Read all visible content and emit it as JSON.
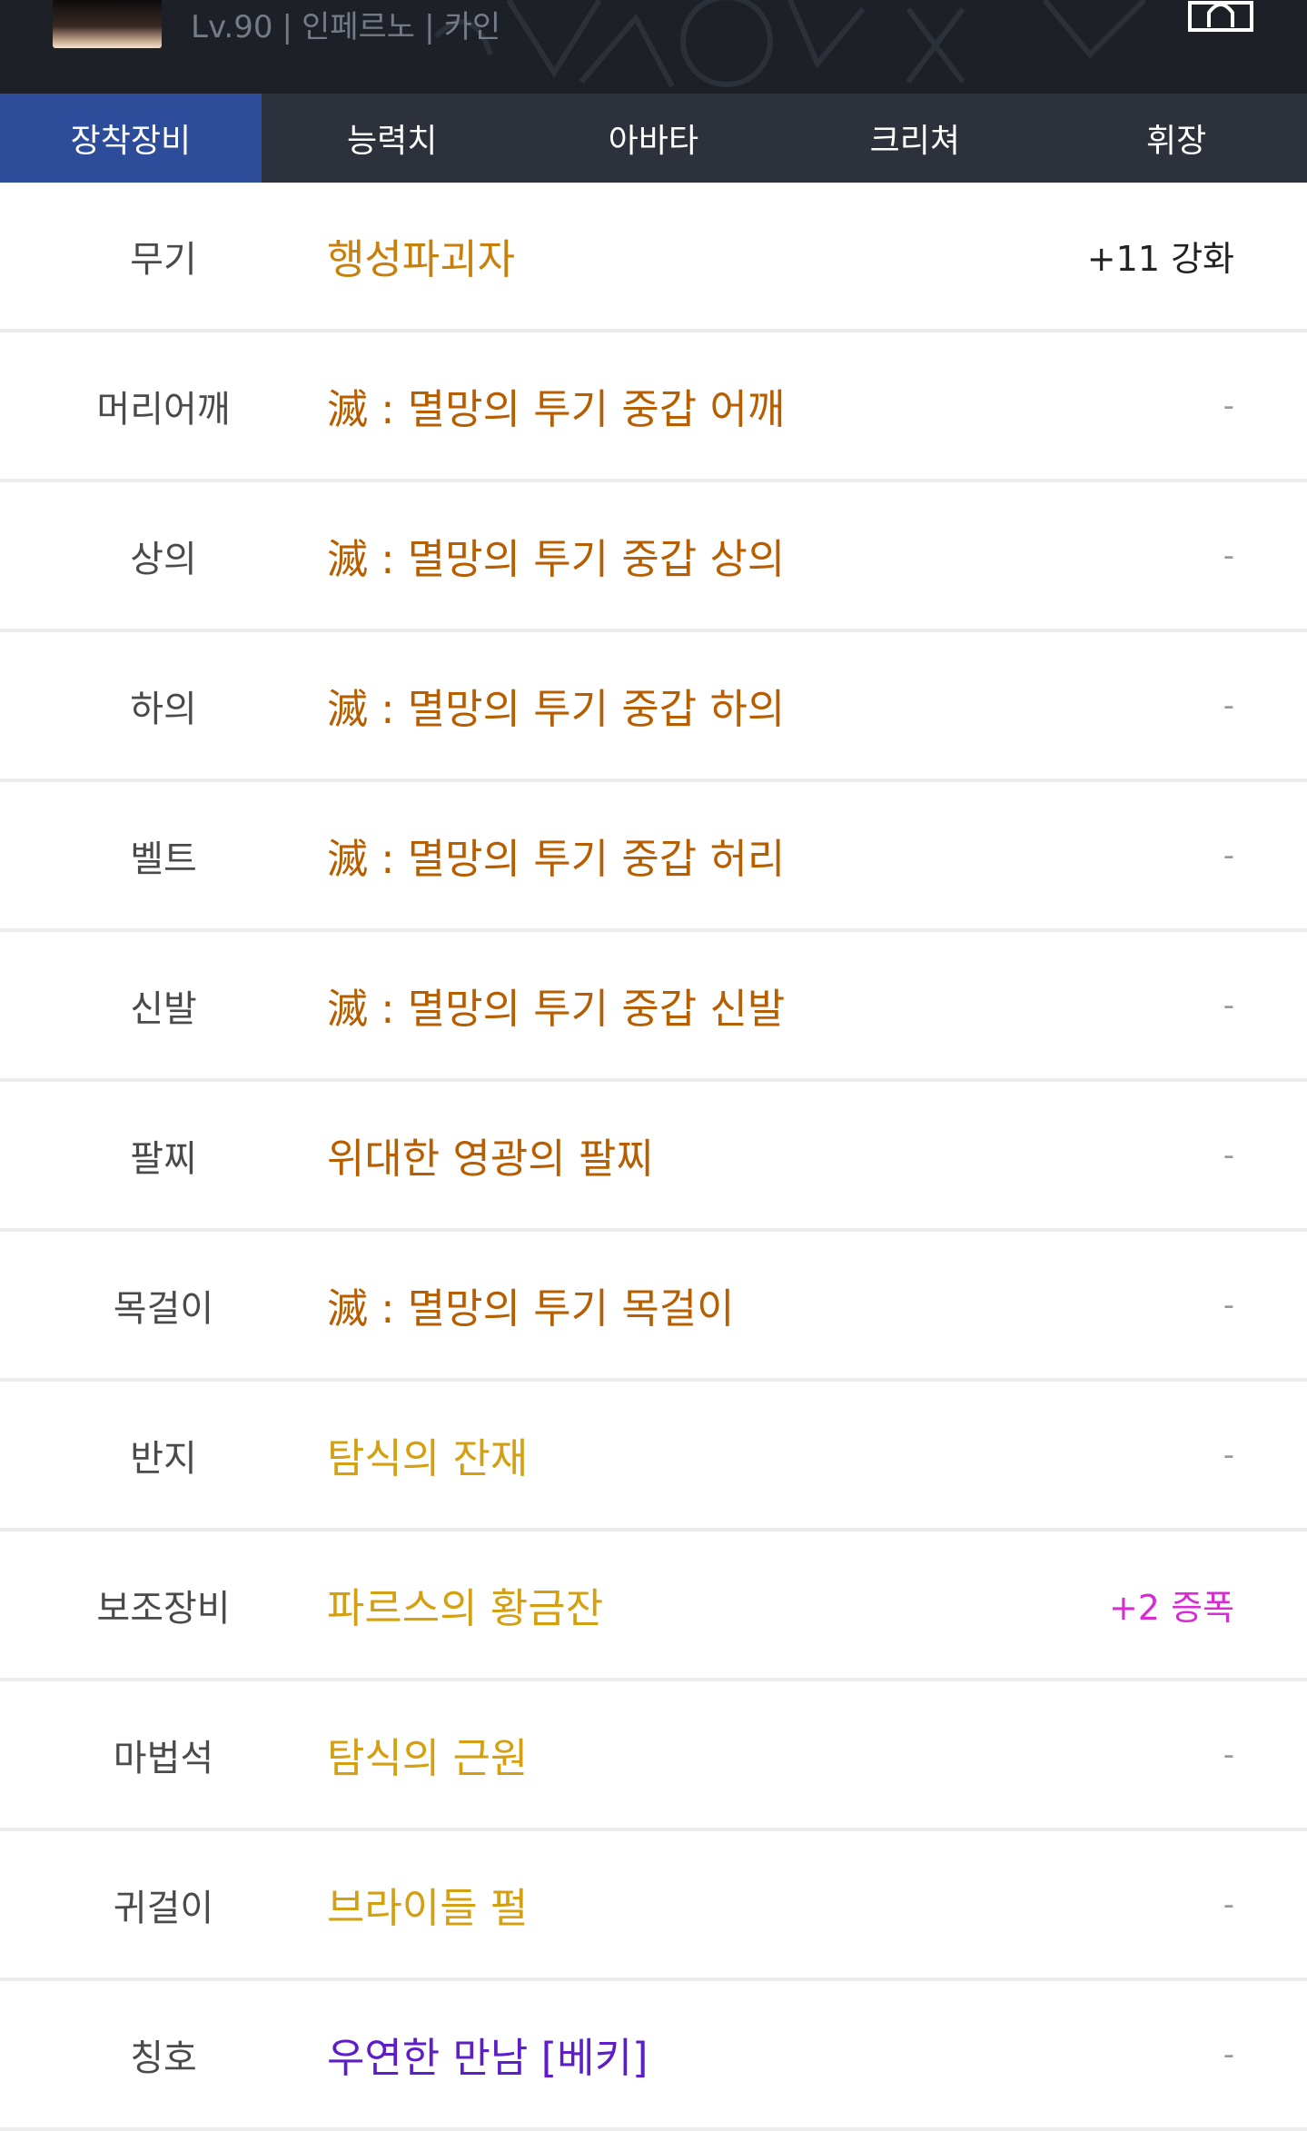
{
  "header": {
    "level": "Lv.90",
    "job": "인페르노",
    "server": "카인",
    "separator": "|"
  },
  "tabs": [
    {
      "label": "장착장비",
      "active": true
    },
    {
      "label": "능력치",
      "active": false
    },
    {
      "label": "아바타",
      "active": false
    },
    {
      "label": "크리쳐",
      "active": false
    },
    {
      "label": "휘장",
      "active": false
    }
  ],
  "colors": {
    "epic": "#c8800c",
    "mythic_set": "#b65e00",
    "legendary": "#c8800c",
    "unique": "#d4a012",
    "rare": "#5d1ec7",
    "amplify": "#d92ad5",
    "tab_active": "#2d4c9a"
  },
  "equipment": [
    {
      "slot": "무기",
      "item": "행성파괴자",
      "grade": "epic",
      "extra": "+11 강화",
      "extra_type": "reinforce"
    },
    {
      "slot": "머리어깨",
      "item": "滅 : 멸망의 투기 중갑 어깨",
      "grade": "mythic_set",
      "extra": "-",
      "extra_type": "dash"
    },
    {
      "slot": "상의",
      "item": "滅 : 멸망의 투기 중갑 상의",
      "grade": "mythic_set",
      "extra": "-",
      "extra_type": "dash"
    },
    {
      "slot": "하의",
      "item": "滅 : 멸망의 투기 중갑 하의",
      "grade": "mythic_set",
      "extra": "-",
      "extra_type": "dash"
    },
    {
      "slot": "벨트",
      "item": "滅 : 멸망의 투기 중갑 허리",
      "grade": "mythic_set",
      "extra": "-",
      "extra_type": "dash"
    },
    {
      "slot": "신발",
      "item": "滅 : 멸망의 투기 중갑 신발",
      "grade": "mythic_set",
      "extra": "-",
      "extra_type": "dash"
    },
    {
      "slot": "팔찌",
      "item": "위대한 영광의 팔찌",
      "grade": "mythic_set",
      "extra": "-",
      "extra_type": "dash"
    },
    {
      "slot": "목걸이",
      "item": "滅 : 멸망의 투기 목걸이",
      "grade": "mythic_set",
      "extra": "-",
      "extra_type": "dash"
    },
    {
      "slot": "반지",
      "item": "탐식의 잔재",
      "grade": "unique",
      "extra": "-",
      "extra_type": "dash"
    },
    {
      "slot": "보조장비",
      "item": "파르스의 황금잔",
      "grade": "unique",
      "extra": "+2 증폭",
      "extra_type": "amplify"
    },
    {
      "slot": "마법석",
      "item": "탐식의 근원",
      "grade": "unique",
      "extra": "-",
      "extra_type": "dash"
    },
    {
      "slot": "귀걸이",
      "item": "브라이들 펄",
      "grade": "unique",
      "extra": "-",
      "extra_type": "dash"
    },
    {
      "slot": "칭호",
      "item": "우연한 만남 [베키]",
      "grade": "rare",
      "extra": "-",
      "extra_type": "dash"
    }
  ]
}
